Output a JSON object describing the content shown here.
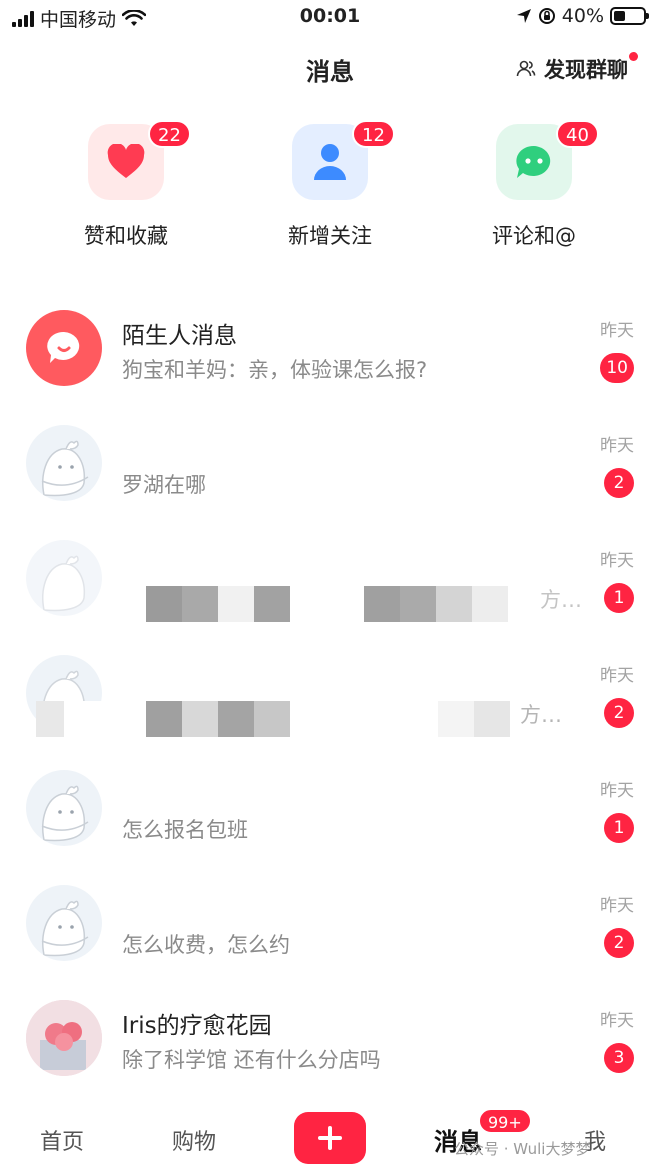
{
  "status_bar": {
    "carrier": "中国移动",
    "time": "00:01",
    "battery": "40%",
    "battery_level": 0.4
  },
  "header": {
    "title": "消息",
    "discover_label": "发现群聊"
  },
  "quick_actions": [
    {
      "label": "赞和收藏",
      "badge": "22",
      "icon": "heart-icon",
      "color": "#ff3b52",
      "bg": "#ffeaea"
    },
    {
      "label": "新增关注",
      "badge": "12",
      "icon": "person-icon",
      "color": "#3d8bff",
      "bg": "#e6efff"
    },
    {
      "label": "评论和@",
      "badge": "40",
      "icon": "chat-bubble-icon",
      "color": "#2fcf7e",
      "bg": "#e4f8ee"
    }
  ],
  "messages": [
    {
      "name": "陌生人消息",
      "preview": "狗宝和羊妈：亲，体验课怎么报?",
      "time": "昨天",
      "badge": "10"
    },
    {
      "name": "",
      "preview": "罗湖在哪",
      "time": "昨天",
      "badge": "2"
    },
    {
      "name": "",
      "preview": "方…",
      "time": "昨天",
      "badge": "1"
    },
    {
      "name": "",
      "preview": "方…",
      "time": "昨天",
      "badge": "2"
    },
    {
      "name": "",
      "preview": "怎么报名包班",
      "time": "昨天",
      "badge": "1"
    },
    {
      "name": "",
      "preview": "怎么收费，怎么约",
      "time": "昨天",
      "badge": "2"
    },
    {
      "name": "Iris的疗愈花园",
      "preview": "除了科学馆 还有什么分店吗",
      "time": "昨天",
      "badge": "3"
    }
  ],
  "tabbar": {
    "home": "首页",
    "shop": "购物",
    "messages": "消息",
    "messages_badge": "99+",
    "me": "我",
    "watermark": "公众号 · Wuli大梦梦"
  }
}
